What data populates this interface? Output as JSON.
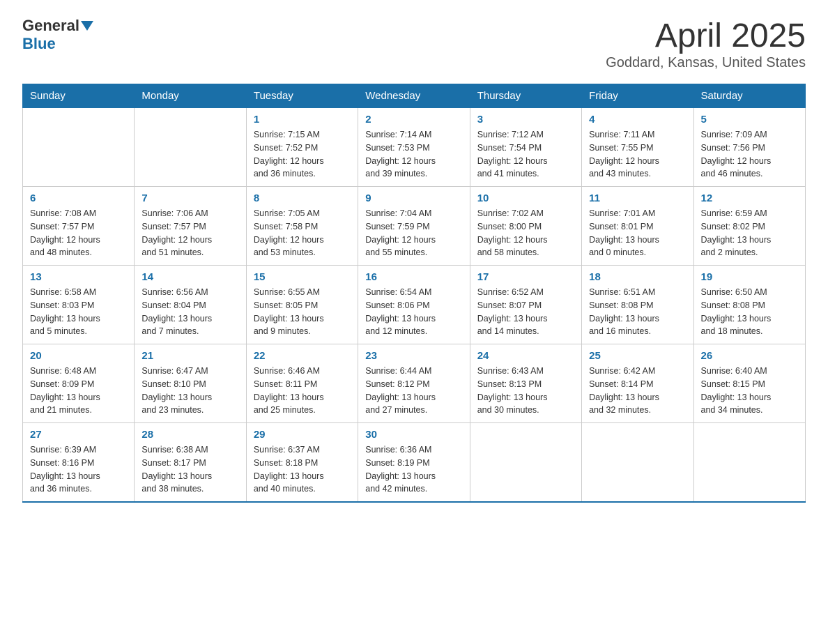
{
  "header": {
    "logo_general": "General",
    "logo_blue": "Blue",
    "title": "April 2025",
    "subtitle": "Goddard, Kansas, United States"
  },
  "days_of_week": [
    "Sunday",
    "Monday",
    "Tuesday",
    "Wednesday",
    "Thursday",
    "Friday",
    "Saturday"
  ],
  "weeks": [
    [
      {
        "num": "",
        "info": ""
      },
      {
        "num": "",
        "info": ""
      },
      {
        "num": "1",
        "info": "Sunrise: 7:15 AM\nSunset: 7:52 PM\nDaylight: 12 hours\nand 36 minutes."
      },
      {
        "num": "2",
        "info": "Sunrise: 7:14 AM\nSunset: 7:53 PM\nDaylight: 12 hours\nand 39 minutes."
      },
      {
        "num": "3",
        "info": "Sunrise: 7:12 AM\nSunset: 7:54 PM\nDaylight: 12 hours\nand 41 minutes."
      },
      {
        "num": "4",
        "info": "Sunrise: 7:11 AM\nSunset: 7:55 PM\nDaylight: 12 hours\nand 43 minutes."
      },
      {
        "num": "5",
        "info": "Sunrise: 7:09 AM\nSunset: 7:56 PM\nDaylight: 12 hours\nand 46 minutes."
      }
    ],
    [
      {
        "num": "6",
        "info": "Sunrise: 7:08 AM\nSunset: 7:57 PM\nDaylight: 12 hours\nand 48 minutes."
      },
      {
        "num": "7",
        "info": "Sunrise: 7:06 AM\nSunset: 7:57 PM\nDaylight: 12 hours\nand 51 minutes."
      },
      {
        "num": "8",
        "info": "Sunrise: 7:05 AM\nSunset: 7:58 PM\nDaylight: 12 hours\nand 53 minutes."
      },
      {
        "num": "9",
        "info": "Sunrise: 7:04 AM\nSunset: 7:59 PM\nDaylight: 12 hours\nand 55 minutes."
      },
      {
        "num": "10",
        "info": "Sunrise: 7:02 AM\nSunset: 8:00 PM\nDaylight: 12 hours\nand 58 minutes."
      },
      {
        "num": "11",
        "info": "Sunrise: 7:01 AM\nSunset: 8:01 PM\nDaylight: 13 hours\nand 0 minutes."
      },
      {
        "num": "12",
        "info": "Sunrise: 6:59 AM\nSunset: 8:02 PM\nDaylight: 13 hours\nand 2 minutes."
      }
    ],
    [
      {
        "num": "13",
        "info": "Sunrise: 6:58 AM\nSunset: 8:03 PM\nDaylight: 13 hours\nand 5 minutes."
      },
      {
        "num": "14",
        "info": "Sunrise: 6:56 AM\nSunset: 8:04 PM\nDaylight: 13 hours\nand 7 minutes."
      },
      {
        "num": "15",
        "info": "Sunrise: 6:55 AM\nSunset: 8:05 PM\nDaylight: 13 hours\nand 9 minutes."
      },
      {
        "num": "16",
        "info": "Sunrise: 6:54 AM\nSunset: 8:06 PM\nDaylight: 13 hours\nand 12 minutes."
      },
      {
        "num": "17",
        "info": "Sunrise: 6:52 AM\nSunset: 8:07 PM\nDaylight: 13 hours\nand 14 minutes."
      },
      {
        "num": "18",
        "info": "Sunrise: 6:51 AM\nSunset: 8:08 PM\nDaylight: 13 hours\nand 16 minutes."
      },
      {
        "num": "19",
        "info": "Sunrise: 6:50 AM\nSunset: 8:08 PM\nDaylight: 13 hours\nand 18 minutes."
      }
    ],
    [
      {
        "num": "20",
        "info": "Sunrise: 6:48 AM\nSunset: 8:09 PM\nDaylight: 13 hours\nand 21 minutes."
      },
      {
        "num": "21",
        "info": "Sunrise: 6:47 AM\nSunset: 8:10 PM\nDaylight: 13 hours\nand 23 minutes."
      },
      {
        "num": "22",
        "info": "Sunrise: 6:46 AM\nSunset: 8:11 PM\nDaylight: 13 hours\nand 25 minutes."
      },
      {
        "num": "23",
        "info": "Sunrise: 6:44 AM\nSunset: 8:12 PM\nDaylight: 13 hours\nand 27 minutes."
      },
      {
        "num": "24",
        "info": "Sunrise: 6:43 AM\nSunset: 8:13 PM\nDaylight: 13 hours\nand 30 minutes."
      },
      {
        "num": "25",
        "info": "Sunrise: 6:42 AM\nSunset: 8:14 PM\nDaylight: 13 hours\nand 32 minutes."
      },
      {
        "num": "26",
        "info": "Sunrise: 6:40 AM\nSunset: 8:15 PM\nDaylight: 13 hours\nand 34 minutes."
      }
    ],
    [
      {
        "num": "27",
        "info": "Sunrise: 6:39 AM\nSunset: 8:16 PM\nDaylight: 13 hours\nand 36 minutes."
      },
      {
        "num": "28",
        "info": "Sunrise: 6:38 AM\nSunset: 8:17 PM\nDaylight: 13 hours\nand 38 minutes."
      },
      {
        "num": "29",
        "info": "Sunrise: 6:37 AM\nSunset: 8:18 PM\nDaylight: 13 hours\nand 40 minutes."
      },
      {
        "num": "30",
        "info": "Sunrise: 6:36 AM\nSunset: 8:19 PM\nDaylight: 13 hours\nand 42 minutes."
      },
      {
        "num": "",
        "info": ""
      },
      {
        "num": "",
        "info": ""
      },
      {
        "num": "",
        "info": ""
      }
    ]
  ]
}
